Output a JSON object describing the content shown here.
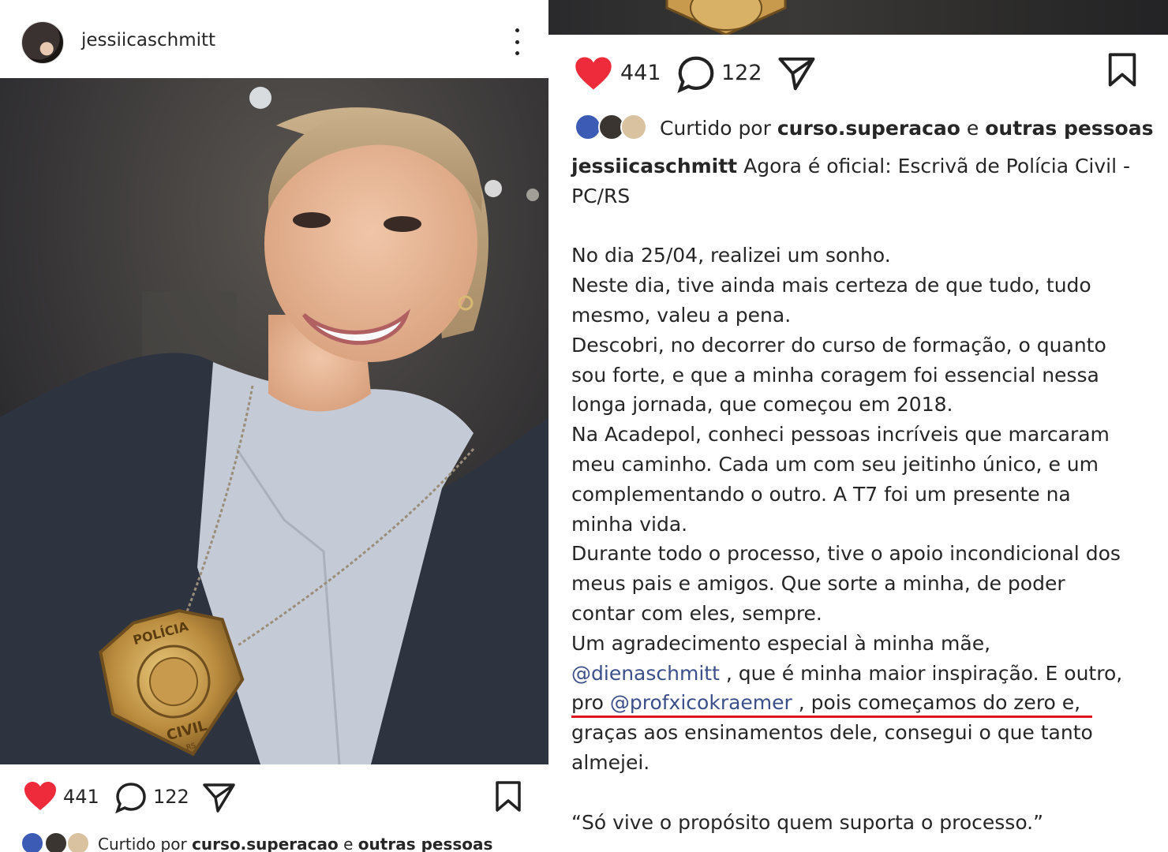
{
  "post": {
    "username": "jessiicaschmitt",
    "likes_count": "441",
    "comments_count": "122",
    "liked_by_prefix": "Curtido por",
    "liked_by_user": "curso.superacao",
    "liked_by_and": "e",
    "liked_by_others": "outras pessoas",
    "badge_top_text": "POLÍCIA",
    "badge_bottom_text": "CIVIL",
    "badge_small_text": "RS"
  },
  "caption": {
    "username": "jessiicaschmitt",
    "intro": "Agora é oficial: Escrivã de Polícia Civil - PC/RS",
    "lines_block1": [
      "No dia 25/04, realizei um sonho.",
      "Neste dia, tive ainda mais certeza de que tudo, tudo",
      "mesmo, valeu a pena.",
      "Descobri, no decorrer do curso de formação, o quanto",
      "sou forte, e que a minha coragem foi essencial nessa",
      "longa jornada, que começou em 2018.",
      "Na Acadepol, conheci pessoas incríveis que marcaram",
      "meu caminho. Cada um com seu jeitinho único, e um",
      "complementando o outro. A T7 foi um presente na",
      "minha vida.",
      "Durante todo o processo, tive o apoio incondicional dos",
      "meus pais e amigos. Que sorte a minha, de poder",
      "contar com eles, sempre.",
      "Um agradecimento especial à minha mãe,"
    ],
    "mention1": "@dienaschmitt",
    "after_mention1": ", que é minha maior inspiração. E outro,",
    "pro_text": "pro",
    "mention2": "@profxicokraemer",
    "after_mention2": ", pois começamos do zero e,",
    "lines_block2": [
      "graças aos ensinamentos dele, consegui o que tanto",
      "almejei."
    ],
    "quote": "“Só vive o propósito quem suporta o processo.”"
  },
  "colors": {
    "heart": "#ee2b3a",
    "mention": "#3b4f8a",
    "underline": "#e0141e"
  },
  "icons": [
    "heart-icon",
    "comment-icon",
    "share-icon",
    "bookmark-icon",
    "more-options-icon"
  ]
}
